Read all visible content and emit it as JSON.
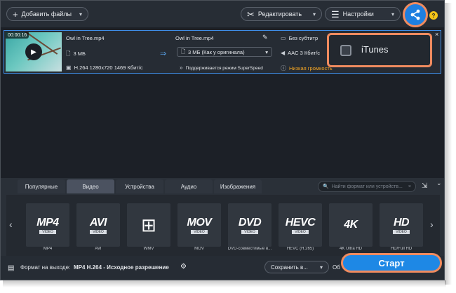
{
  "toolbar": {
    "add_files": "Добавить файлы",
    "edit": "Редактировать",
    "settings": "Настройки",
    "help": "?"
  },
  "file": {
    "duration": "00:00:16",
    "source_name": "Owl in Tree.mp4",
    "source_size": "3 МБ",
    "source_codec": "H.264 1280x720 1469 Кбит/с",
    "output_name": "Owl in Tree.mp4",
    "output_size": "3 МБ (Как у оригинала)",
    "superspeed": "Поддерживается режим SuperSpeed",
    "subtitles": "Без субтитр",
    "audio": "AAC 3 Кбит/с",
    "warning": "Низкая громкость"
  },
  "share_popup": {
    "itunes_label": "iTunes"
  },
  "tabs": [
    {
      "label": "Популярные"
    },
    {
      "label": "Видео"
    },
    {
      "label": "Устройства"
    },
    {
      "label": "Аудио"
    },
    {
      "label": "Изображения"
    }
  ],
  "search": {
    "placeholder": "Найти формат или устройств..."
  },
  "formats": [
    {
      "big": "MP4",
      "sub": "VIDEO",
      "label": "MP4"
    },
    {
      "big": "AVI",
      "sub": "VIDEO",
      "label": "AVI"
    },
    {
      "big": "",
      "sub": "",
      "label": "WMV"
    },
    {
      "big": "MOV",
      "sub": "VIDEO",
      "label": "MOV"
    },
    {
      "big": "DVD",
      "sub": "VIDEO",
      "label": "DVD-совместимые в..."
    },
    {
      "big": "HEVC",
      "sub": "VIDEO",
      "label": "HEVC (H.265)"
    },
    {
      "big": "4K",
      "sub": "",
      "label": "4K Ultra HD"
    },
    {
      "big": "HD",
      "sub": "VIDEO",
      "label": "HD/Full HD"
    }
  ],
  "footer": {
    "output_label": "Формат на выходе:",
    "output_value": "MP4 H.264 - Исходное разрешение",
    "save_to": "Сохранить в...",
    "start": "Старт"
  },
  "colors": {
    "accent": "#1e88e5",
    "highlight": "#f08b5f",
    "selection": "#3f8ee8",
    "warning": "#f5a623"
  }
}
